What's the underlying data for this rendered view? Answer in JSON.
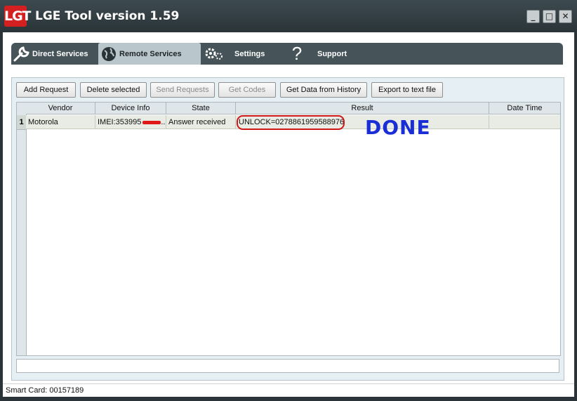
{
  "window": {
    "logo_text": "LGT",
    "title": "LGE Tool version 1.59",
    "minimize_icon": "minimize-icon",
    "maximize_icon": "maximize-icon",
    "close_icon": "close-icon"
  },
  "tabs": [
    {
      "label": "Direct Services",
      "icon": "wrench-icon",
      "active": false
    },
    {
      "label": "Remote Services",
      "icon": "globe-icon",
      "active": true
    },
    {
      "label": "Settings",
      "icon": "gears-icon",
      "active": false
    },
    {
      "label": "Support",
      "icon": "question-icon",
      "active": false
    }
  ],
  "toolbar": {
    "add_request": "Add Request",
    "delete_selected": "Delete selected",
    "send_requests": "Send Requests",
    "get_codes": "Get Codes",
    "get_data_history": "Get Data from History",
    "export_text": "Export to text file"
  },
  "table": {
    "columns": [
      "Vendor",
      "Device Info",
      "State",
      "Result",
      "Date Time"
    ],
    "rows": [
      {
        "num": "1",
        "vendor": "Motorola",
        "device_info": "IMEI:353995",
        "device_info_suffix": "...",
        "state": "Answer received",
        "result": "UNLOCK=0278861959588976",
        "date_time": ""
      }
    ]
  },
  "annotation": {
    "text": "DONE",
    "color": "#1a2ed6",
    "highlight_color": "#d01818"
  },
  "status": {
    "smart_card": "Smart Card: 00157189"
  }
}
